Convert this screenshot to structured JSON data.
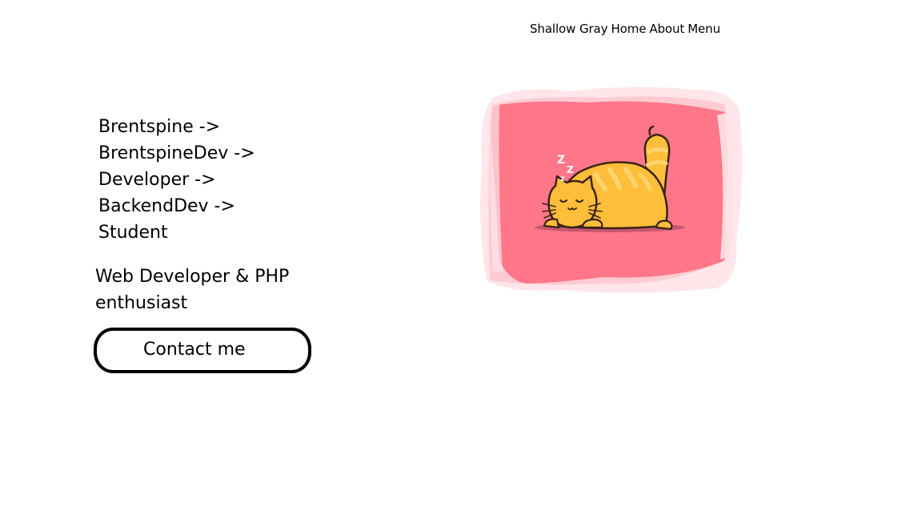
{
  "nav": {
    "brand": "Shallow Gray",
    "home": "Home",
    "about": "About",
    "menu": "Menu"
  },
  "roles": [
    "Brentspine ->",
    "BrentspineDev ->",
    "Developer ->",
    "BackendDev ->",
    "Student"
  ],
  "tagline": "Web Developer & PHP enthusiast",
  "contact_button": "Contact me",
  "hero": {
    "image": "sleeping-cat-illustration",
    "sleep_letters": [
      "Z",
      "Z",
      "z"
    ],
    "colors": {
      "background": "#ff7788",
      "cat": "#ffbe3a",
      "stripes": "#ffd46e",
      "shadow": "#c65870",
      "outline": "#3a2418"
    }
  }
}
